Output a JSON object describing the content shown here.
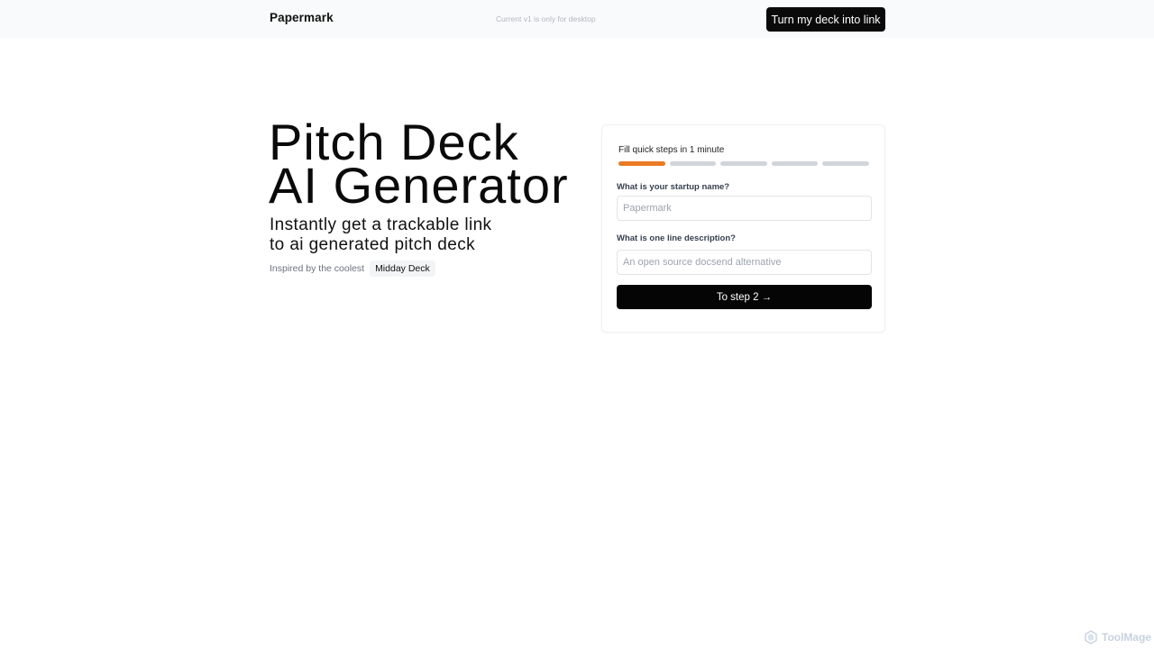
{
  "header": {
    "brand": "Papermark",
    "notice": "Current v1 is only for desktop",
    "cta_label": "Turn my deck into link"
  },
  "hero": {
    "title_line1": "Pitch Deck",
    "title_line2": "AI Generator",
    "subtitle_line1": "Instantly get a trackable link",
    "subtitle_line2": "to ai generated pitch deck",
    "inspired_label": "Inspired by the coolest",
    "inspired_link": "Midday Deck"
  },
  "form": {
    "step_text": "Fill quick steps in 1 minute",
    "progress": {
      "current_step": 1,
      "total_steps": 5
    },
    "q1_label": "What is your startup name?",
    "q1_placeholder": "Papermark",
    "q1_value": "",
    "q2_label": "What is one line description?",
    "q2_placeholder": "An open source docsend alternative",
    "q2_value": "",
    "next_label": "To step 2 →"
  },
  "watermark": {
    "text": "ToolMage",
    "icon": "hexagon-logo-icon"
  },
  "colors": {
    "accent": "#ea7a23",
    "progress_inactive": "#d1d5db",
    "button_bg": "#0a0a0a",
    "topbar_bg": "#f9fafb"
  }
}
